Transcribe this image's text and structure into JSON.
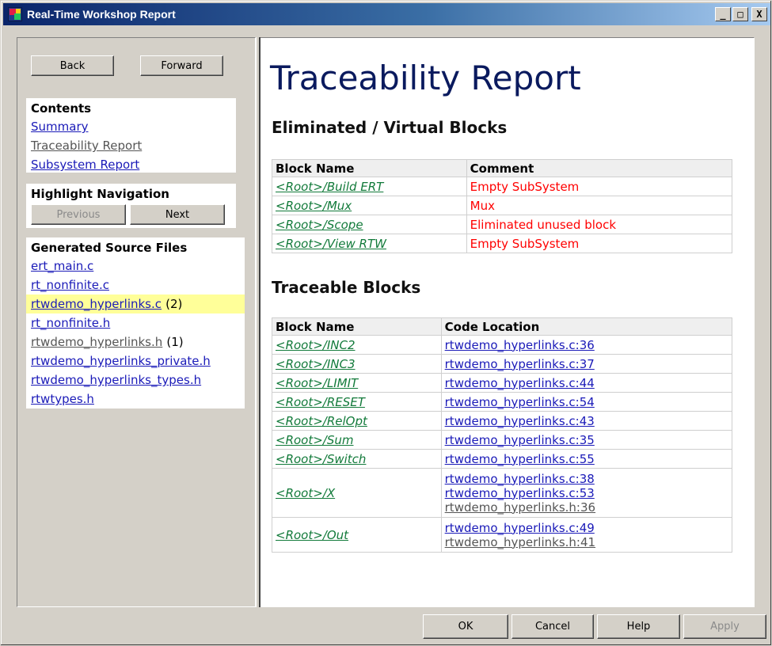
{
  "window": {
    "title": "Real-Time Workshop Report",
    "controls": {
      "minimize": "_",
      "maximize": "□",
      "close": "X"
    }
  },
  "nav": {
    "back_label": "Back",
    "forward_label": "Forward"
  },
  "contents": {
    "title": "Contents",
    "links": [
      "Summary",
      "Traceability Report",
      "Subsystem Report"
    ]
  },
  "highlight_navigation": {
    "title": "Highlight Navigation",
    "previous_label": "Previous",
    "next_label": "Next"
  },
  "generated_files": {
    "title": "Generated Source Files",
    "files": [
      {
        "name": "ert_main.c",
        "count": ""
      },
      {
        "name": "rt_nonfinite.c",
        "count": ""
      },
      {
        "name": "rtwdemo_hyperlinks.c",
        "count": "(2)"
      },
      {
        "name": "rt_nonfinite.h",
        "count": ""
      },
      {
        "name": "rtwdemo_hyperlinks.h",
        "count": "(1)"
      },
      {
        "name": "rtwdemo_hyperlinks_private.h",
        "count": ""
      },
      {
        "name": "rtwdemo_hyperlinks_types.h",
        "count": ""
      },
      {
        "name": "rtwtypes.h",
        "count": ""
      }
    ]
  },
  "report": {
    "title": "Traceability Report",
    "eliminated": {
      "heading": "Eliminated / Virtual Blocks",
      "columns": [
        "Block Name",
        "Comment"
      ],
      "rows": [
        {
          "block": "<Root>/Build ERT",
          "comment": "Empty SubSystem"
        },
        {
          "block": "<Root>/Mux",
          "comment": "Mux"
        },
        {
          "block": "<Root>/Scope",
          "comment": "Eliminated unused block"
        },
        {
          "block": "<Root>/View RTW",
          "comment": "Empty SubSystem"
        }
      ]
    },
    "traceable": {
      "heading": "Traceable Blocks",
      "columns": [
        "Block Name",
        "Code Location"
      ],
      "rows": [
        {
          "block": "<Root>/INC2",
          "locations": [
            "rtwdemo_hyperlinks.c:36"
          ]
        },
        {
          "block": "<Root>/INC3",
          "locations": [
            "rtwdemo_hyperlinks.c:37"
          ]
        },
        {
          "block": "<Root>/LIMIT",
          "locations": [
            "rtwdemo_hyperlinks.c:44"
          ]
        },
        {
          "block": "<Root>/RESET",
          "locations": [
            "rtwdemo_hyperlinks.c:54"
          ]
        },
        {
          "block": "<Root>/RelOpt",
          "locations": [
            "rtwdemo_hyperlinks.c:43"
          ]
        },
        {
          "block": "<Root>/Sum",
          "locations": [
            "rtwdemo_hyperlinks.c:35"
          ]
        },
        {
          "block": "<Root>/Switch",
          "locations": [
            "rtwdemo_hyperlinks.c:55"
          ]
        },
        {
          "block": "<Root>/X",
          "locations": [
            "rtwdemo_hyperlinks.c:38",
            "rtwdemo_hyperlinks.c:53",
            "rtwdemo_hyperlinks.h:36"
          ]
        },
        {
          "block": "<Root>/Out",
          "locations": [
            "rtwdemo_hyperlinks.c:49",
            "rtwdemo_hyperlinks.h:41"
          ]
        }
      ]
    }
  },
  "dialog_buttons": {
    "ok": "OK",
    "cancel": "Cancel",
    "help": "Help",
    "apply": "Apply"
  }
}
